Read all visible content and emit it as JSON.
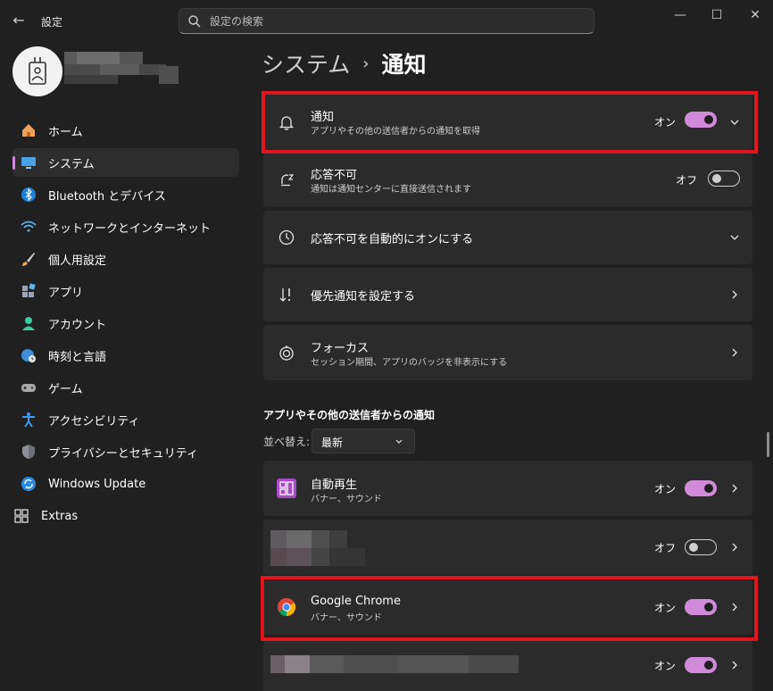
{
  "window": {
    "app_title": "設定",
    "back_glyph": "←",
    "controls": {
      "minimize": "—",
      "maximize": "☐",
      "close": "✕"
    }
  },
  "search": {
    "placeholder": "設定の検索"
  },
  "sidebar": {
    "items": [
      {
        "label": "ホーム",
        "icon": "home-icon"
      },
      {
        "label": "システム",
        "icon": "system-icon"
      },
      {
        "label": "Bluetooth とデバイス",
        "icon": "bluetooth-icon"
      },
      {
        "label": "ネットワークとインターネット",
        "icon": "wifi-icon"
      },
      {
        "label": "個人用設定",
        "icon": "brush-icon"
      },
      {
        "label": "アプリ",
        "icon": "apps-icon"
      },
      {
        "label": "アカウント",
        "icon": "account-icon"
      },
      {
        "label": "時刻と言語",
        "icon": "globe-clock-icon"
      },
      {
        "label": "ゲーム",
        "icon": "gamepad-icon"
      },
      {
        "label": "アクセシビリティ",
        "icon": "accessibility-icon"
      },
      {
        "label": "プライバシーとセキュリティ",
        "icon": "shield-icon"
      },
      {
        "label": "Windows Update",
        "icon": "update-icon"
      },
      {
        "label": "Extras",
        "icon": "extras-icon"
      }
    ],
    "active_index": 1
  },
  "header": {
    "parent": "システム",
    "separator": "›",
    "current": "通知"
  },
  "settings": {
    "notifications": {
      "title": "通知",
      "subtitle": "アプリやその他の送信者からの通知を取得",
      "state": "オン"
    },
    "dnd": {
      "title": "応答不可",
      "subtitle": "通知は通知センターに直接送信されます",
      "state": "オフ"
    },
    "dnd_auto": {
      "title": "応答不可を自動的にオンにする"
    },
    "priority": {
      "title": "優先通知を設定する"
    },
    "focus": {
      "title": "フォーカス",
      "subtitle": "セッション期間、アプリのバッジを非表示にする"
    }
  },
  "apps_section": {
    "title": "アプリやその他の送信者からの通知",
    "sort_label": "並べ替え:",
    "sort_value": "最新",
    "apps": [
      {
        "name": "自動再生",
        "detail": "バナー、サウンド",
        "state": "オン"
      },
      {
        "name": "",
        "detail": "",
        "state": "オフ"
      },
      {
        "name": "Google Chrome",
        "detail": "バナー、サウンド",
        "state": "オン"
      },
      {
        "name": "",
        "detail": "",
        "state": "オン"
      }
    ]
  },
  "colors": {
    "accent": "#d08ad9",
    "highlight": "#e0161c",
    "background": "#202020",
    "card": "#2b2b2b"
  }
}
